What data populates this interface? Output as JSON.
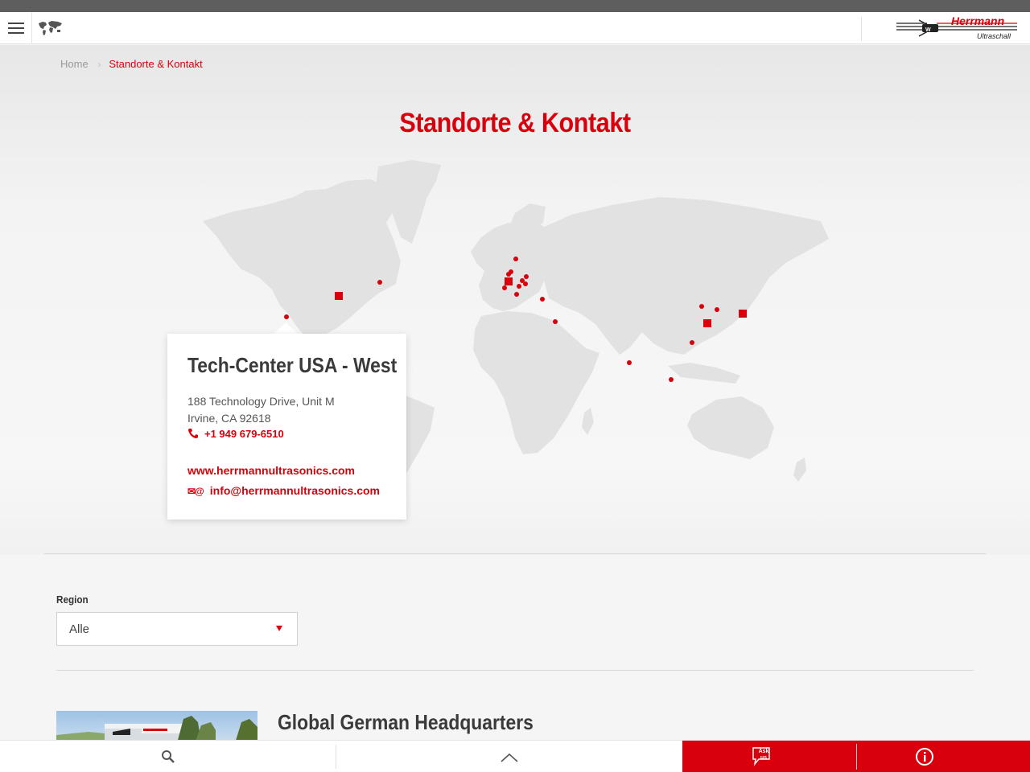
{
  "breadcrumb": {
    "home": "Home",
    "current": "Standorte & Kontakt"
  },
  "page": {
    "title": "Standorte & Kontakt"
  },
  "logo": {
    "brand": "Herrmann",
    "sub": "Ultraschall"
  },
  "popup": {
    "title": "Tech-Center USA - West",
    "address_line1": "188 Technology Drive, Unit M",
    "address_line2": "Irvine, CA 92618",
    "phone": "+1 949 679-6510",
    "website": "www.herrmannultrasonics.com",
    "email": "info@herrmannultrasonics.com"
  },
  "filter": {
    "label": "Region",
    "selected": "Alle"
  },
  "locations": [
    {
      "title": "Global German Headquarters"
    }
  ],
  "bottombar": {
    "ask_label_line1": "Ask",
    "ask_label_line2": "us"
  },
  "colors": {
    "accent": "#d9000d",
    "topstrip": "#5e5e5e",
    "map_land": "#e2e2e2"
  },
  "icons": [
    "menu-icon",
    "world-map-icon",
    "phone-icon",
    "mail-icon",
    "search-icon",
    "chevron-up-icon",
    "chat-icon",
    "info-icon"
  ]
}
